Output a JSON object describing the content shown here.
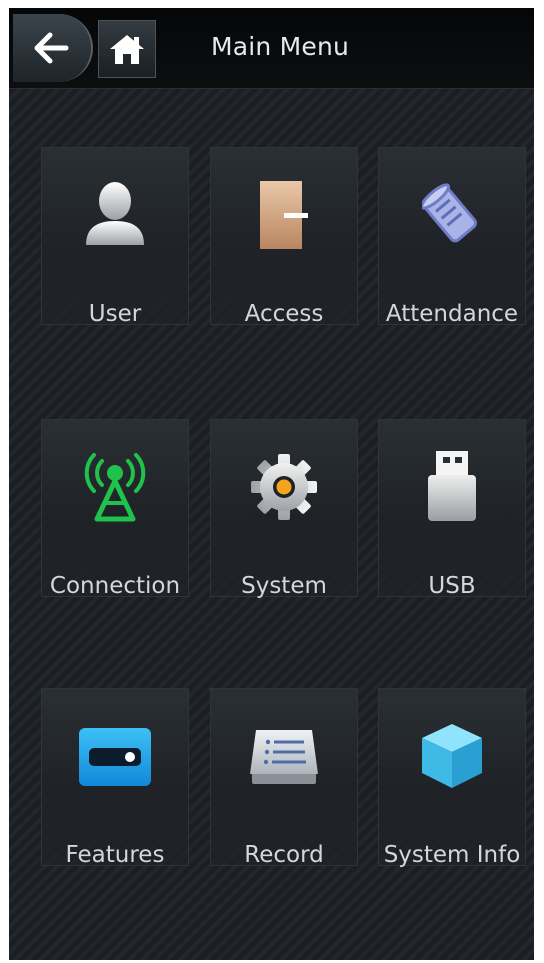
{
  "header": {
    "title": "Main Menu",
    "back_icon": "arrow-left-icon",
    "home_icon": "home-icon"
  },
  "menu": {
    "items": [
      {
        "label": "User",
        "icon": "user-icon"
      },
      {
        "label": "Access",
        "icon": "door-icon"
      },
      {
        "label": "Attendance",
        "icon": "scroll-icon"
      },
      {
        "label": "Connection",
        "icon": "antenna-icon"
      },
      {
        "label": "System",
        "icon": "gear-icon"
      },
      {
        "label": "USB",
        "icon": "usb-drive-icon"
      },
      {
        "label": "Features",
        "icon": "toggle-card-icon"
      },
      {
        "label": "Record",
        "icon": "list-icon"
      },
      {
        "label": "System Info",
        "icon": "cube-icon"
      }
    ]
  },
  "colors": {
    "background": "#1b1e22",
    "header": "#07090a",
    "connection_green": "#1fc24a",
    "gear_orange": "#f6a31d",
    "features_blue": "#1aa7e8",
    "cube_cyan": "#4fd0f2"
  }
}
